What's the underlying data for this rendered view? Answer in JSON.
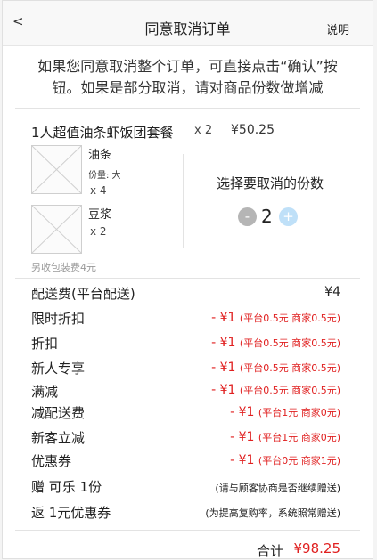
{
  "header": {
    "back_label": "<",
    "title": "同意取消订单",
    "help_label": "说明"
  },
  "intro": {
    "line1": "如果您同意取消整个订单，可直接点击“确认”按",
    "line2": "钮。如果是部分取消，请对商品份数做增减"
  },
  "combo": {
    "name": "1人超值油条虾饭团套餐",
    "qty": "x 2",
    "price": "¥50.25",
    "items": [
      {
        "name": "油条",
        "spec": "份量: 大",
        "qty": "x 4"
      },
      {
        "name": "豆浆",
        "spec": "",
        "qty": "x 2"
      }
    ],
    "pack_fee": "另收包装费4元"
  },
  "cancel": {
    "label": "选择要取消的份数",
    "minus": "-",
    "value": "2",
    "plus": "+"
  },
  "fees": [
    {
      "label": "配送费(平台配送)",
      "amount": "¥4",
      "detail": ""
    },
    {
      "label": "限时折扣",
      "amount": "- ¥1",
      "detail": "(平台0.5元 商家0.5元)"
    },
    {
      "label": "折扣",
      "amount": "- ¥1",
      "detail": "(平台0.5元 商家0.5元)"
    },
    {
      "label": "新人专享",
      "amount": "- ¥1",
      "detail": "(平台0.5元 商家0.5元)"
    },
    {
      "label": "满减",
      "amount": "- ¥1",
      "detail": "(平台0.5元 商家0.5元)"
    },
    {
      "label": "减配送费",
      "amount": "- ¥1",
      "detail": "(平台1元 商家0元)"
    },
    {
      "label": "新客立减",
      "amount": "- ¥1",
      "detail": "(平台1元 商家0元)"
    },
    {
      "label": "优惠券",
      "amount": "- ¥1",
      "detail": "(平台0元 商家1元)"
    }
  ],
  "gifts": [
    {
      "label": "赠 可乐 1份",
      "note": "(请与顾客协商是否继续赠送)"
    },
    {
      "label": "返 1元优惠券",
      "note": "(为提高复购率，系统照常赠送)"
    }
  ],
  "total": {
    "label": "合计",
    "value": "¥98.25"
  },
  "colors": {
    "discount_red": "#e02020",
    "plus_button": "#bfe0f8",
    "minus_button": "#b5b5b5"
  }
}
